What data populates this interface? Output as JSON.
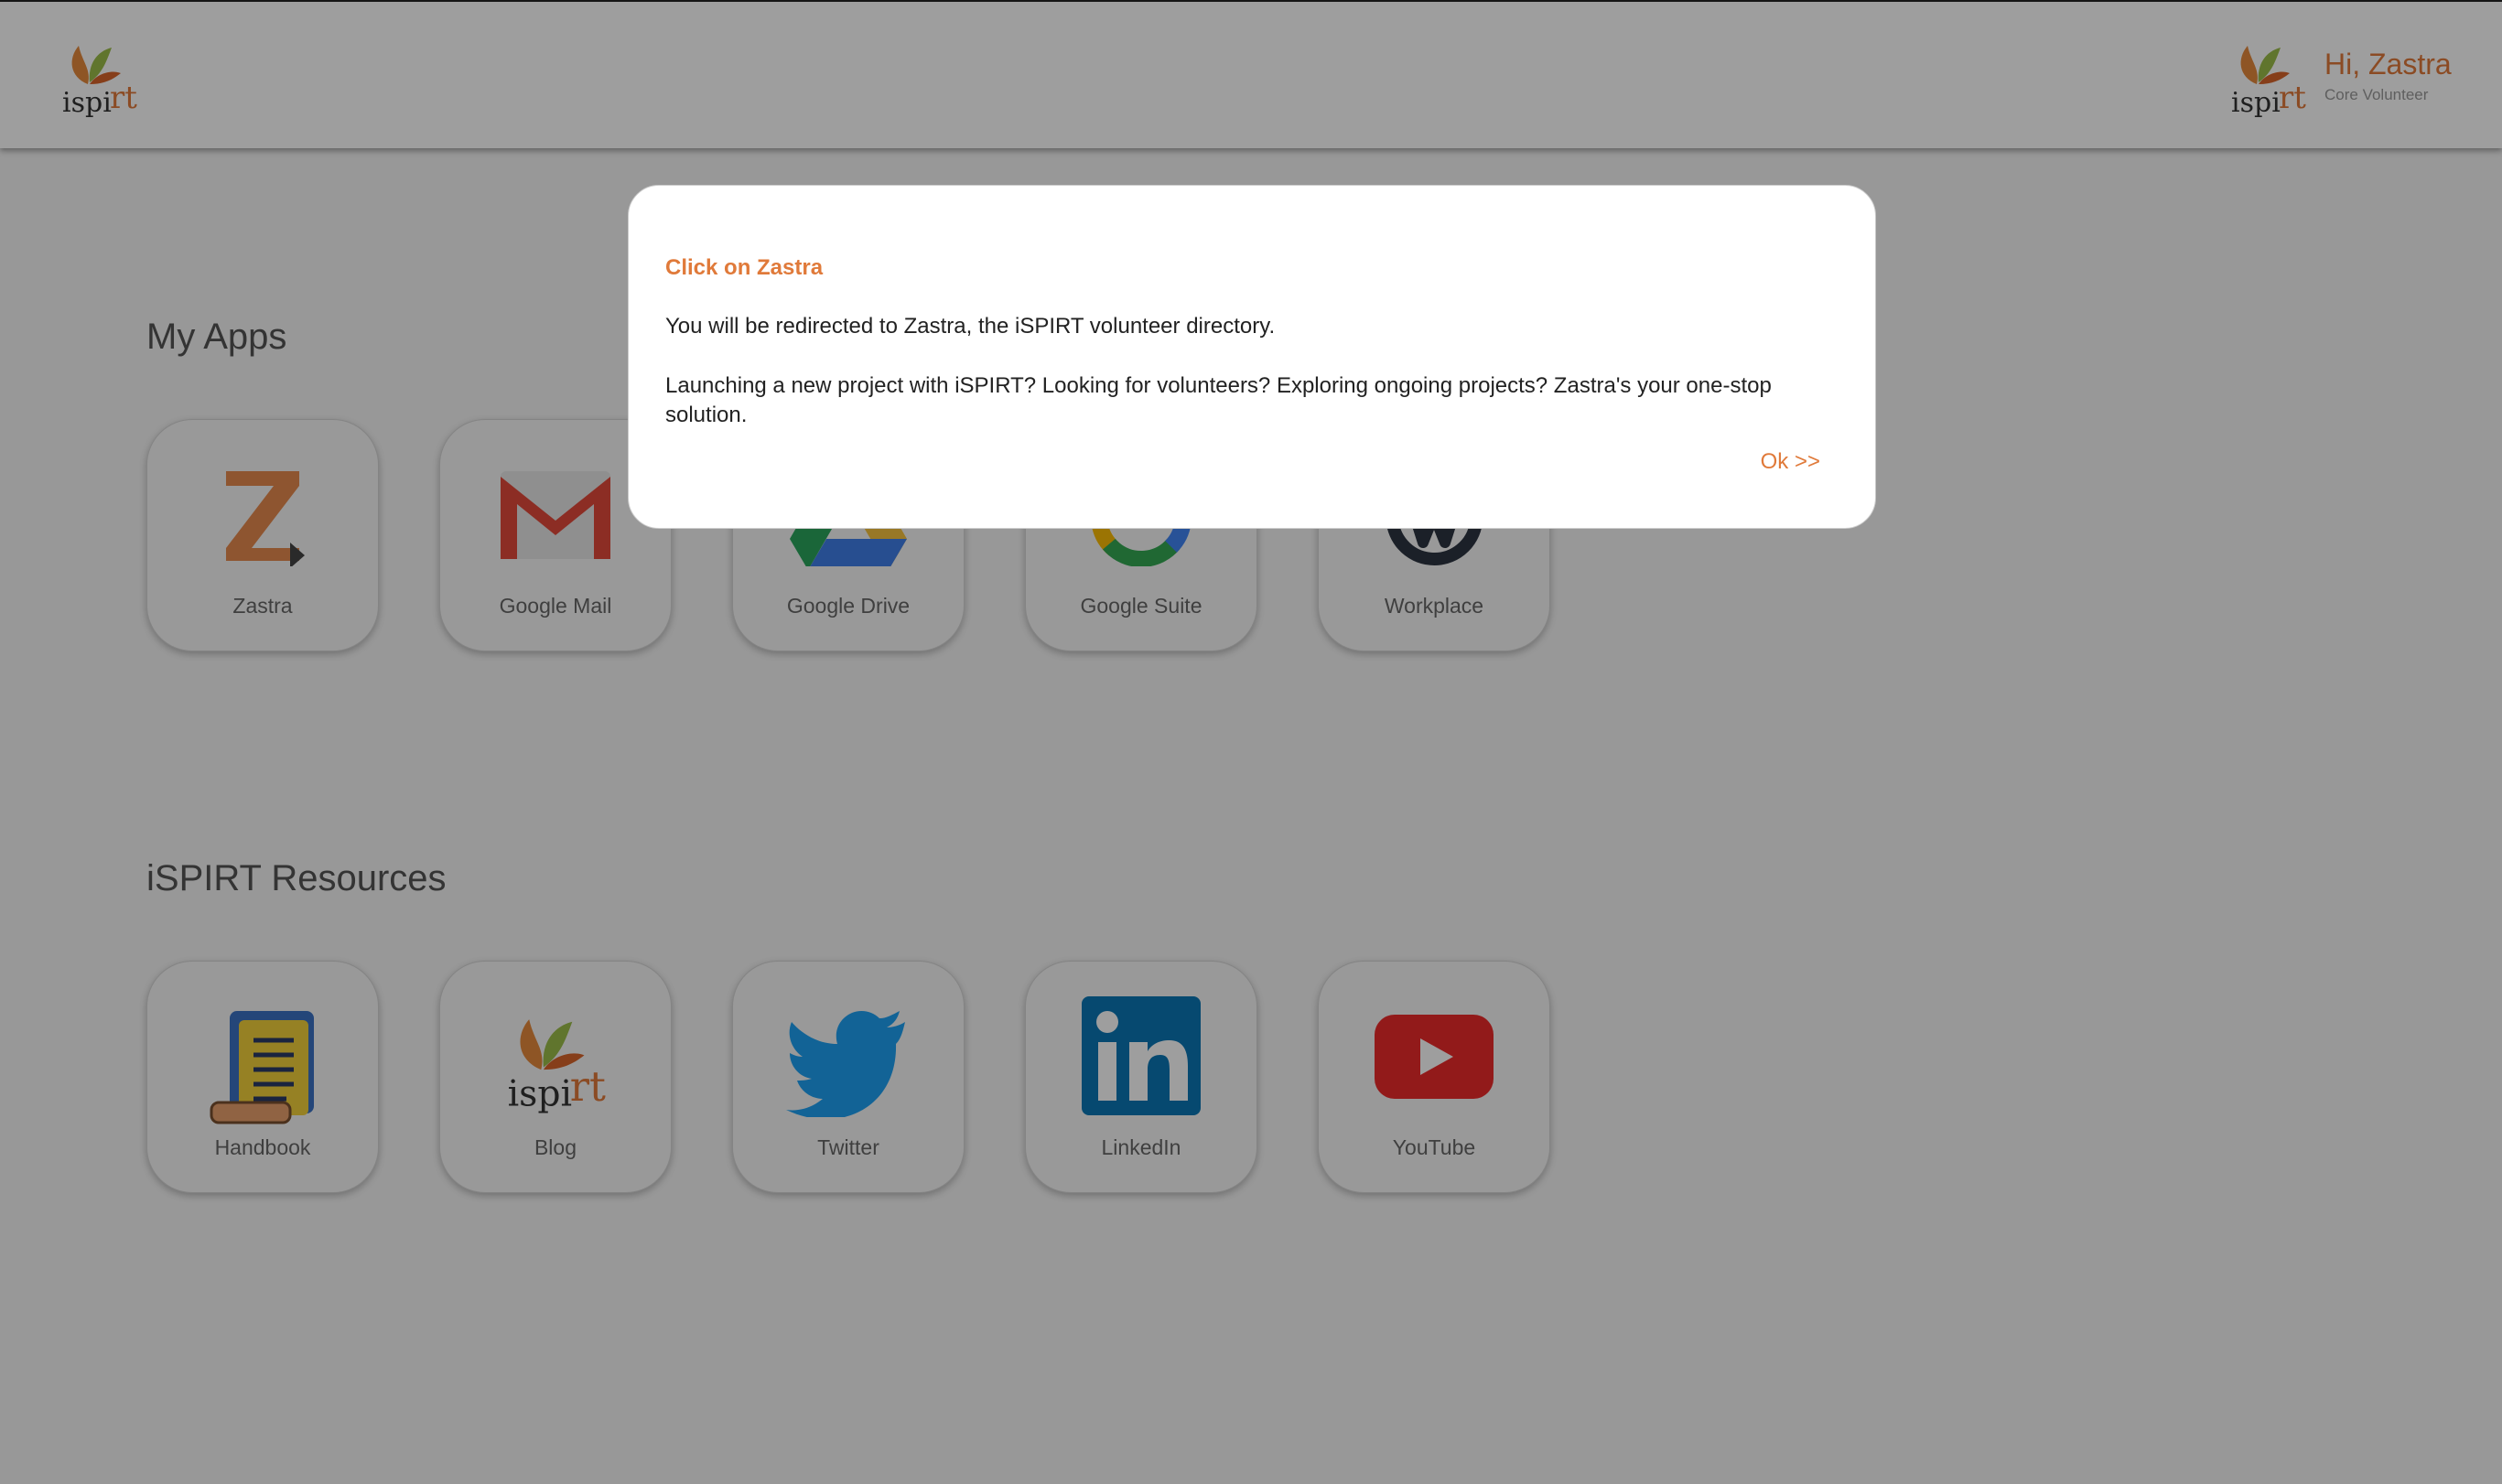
{
  "header": {
    "greeting": "Hi, Zastra",
    "role": "Core Volunteer"
  },
  "sections": {
    "apps_title": "My Apps",
    "resources_title": "iSPIRT Resources"
  },
  "apps": [
    {
      "label": "Zastra",
      "icon": "zastra-icon"
    },
    {
      "label": "Google Mail",
      "icon": "gmail-icon"
    },
    {
      "label": "Google Drive",
      "icon": "google-drive-icon"
    },
    {
      "label": "Google Suite",
      "icon": "google-suite-icon"
    },
    {
      "label": "Workplace",
      "icon": "workplace-icon"
    }
  ],
  "resources": [
    {
      "label": "Handbook",
      "icon": "handbook-icon"
    },
    {
      "label": "Blog",
      "icon": "ispirt-logo-icon"
    },
    {
      "label": "Twitter",
      "icon": "twitter-icon"
    },
    {
      "label": "LinkedIn",
      "icon": "linkedin-icon"
    },
    {
      "label": "YouTube",
      "icon": "youtube-icon"
    }
  ],
  "modal": {
    "title": "Click on Zastra",
    "paragraph1": "You will be redirected to Zastra, the iSPIRT volunteer directory.",
    "paragraph2": "Launching a new project with iSPIRT? Looking for volunteers? Exploring ongoing projects? Zastra's your one-stop solution.",
    "ok_label": "Ok >>"
  },
  "colors": {
    "accent": "#e07a3a",
    "overlay": "rgba(0,0,0,0.38)"
  }
}
